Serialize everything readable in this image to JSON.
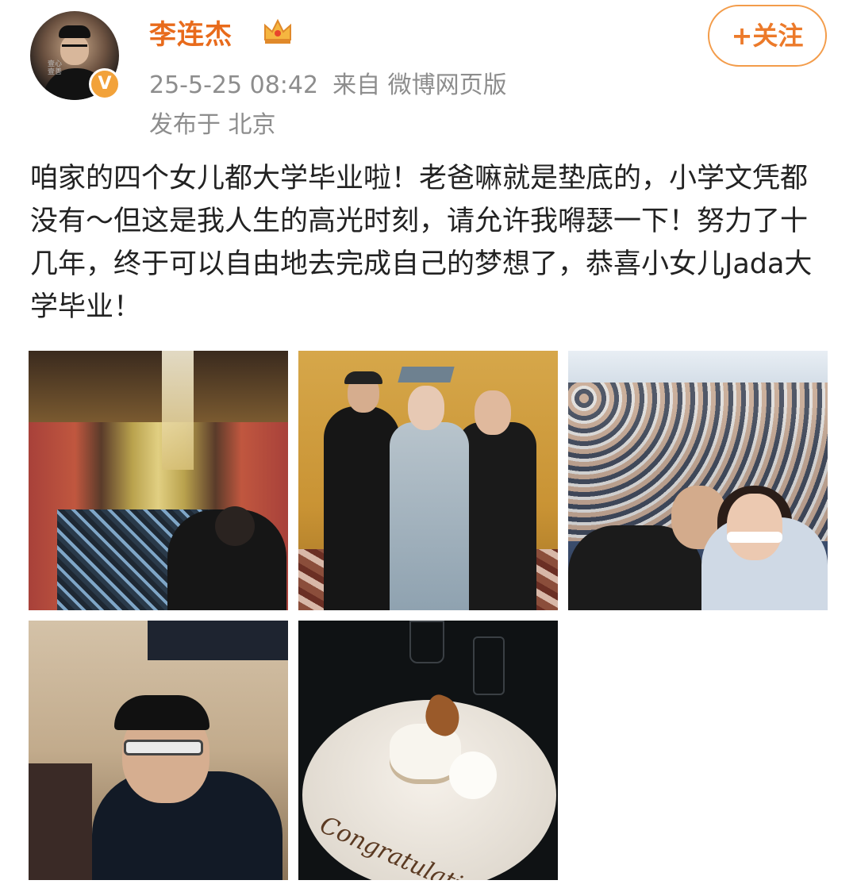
{
  "header": {
    "username": "李连杰",
    "verified_badge": "V",
    "avatar_caption": "壹心壹善",
    "timestamp": "25-5-25 08:42",
    "source": "来自 微博网页版",
    "location": "发布于 北京",
    "follow_label": "+关注"
  },
  "post": {
    "text": "咱家的四个女儿都大学毕业啦！老爸嘛就是垫底的，小学文凭都没有～但这是我人生的高光时刻，请允许我嘚瑟一下！努力了十几年，终于可以自由地去完成自己的梦想了，恭喜小女儿Jada大学毕业！"
  },
  "photos": {
    "dessert_text": "Congratulations"
  },
  "colors": {
    "username": "#e86b1c",
    "follow_border": "#f39c4a",
    "meta_text": "#8d8d8d",
    "badge": "#f2a23a"
  },
  "icons": {
    "crown": "crown-icon",
    "verified": "verified-badge-icon"
  }
}
